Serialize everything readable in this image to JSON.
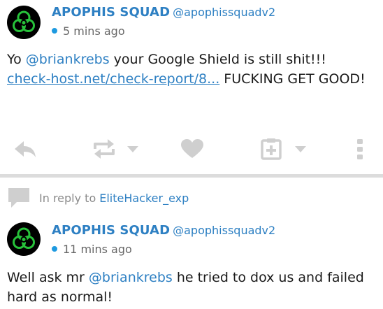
{
  "tweets": [
    {
      "author_name": "APOPHIS SQUAD",
      "handle": "@apophissquadv2",
      "time": "5 mins ago",
      "text_parts": {
        "p1": "Yo ",
        "mention": "@briankrebs",
        "p2": " your Google Shield is still shit!!! ",
        "link": "check-host.net/check-report/8...",
        "p3": " FUCKING GET GOOD!"
      },
      "actions": [
        "reply-icon",
        "retweet-icon",
        "like-icon",
        "bookmark-icon",
        "more-icon"
      ]
    },
    {
      "author_name": "APOPHIS SQUAD",
      "handle": "@apophissquadv2",
      "time": "11 mins ago",
      "text_parts": {
        "p1": "Well ask mr ",
        "mention": "@briankrebs",
        "p2": " he tried to dox us and failed hard as normal!"
      }
    }
  ],
  "reply_context": {
    "label": "In reply to",
    "user": "EliteHacker_exp"
  },
  "colors": {
    "accent": "#2e80c3",
    "online_dot": "#1e9ae0",
    "icon_gray": "#cfcfcf",
    "avatar_green": "#27c23a"
  }
}
